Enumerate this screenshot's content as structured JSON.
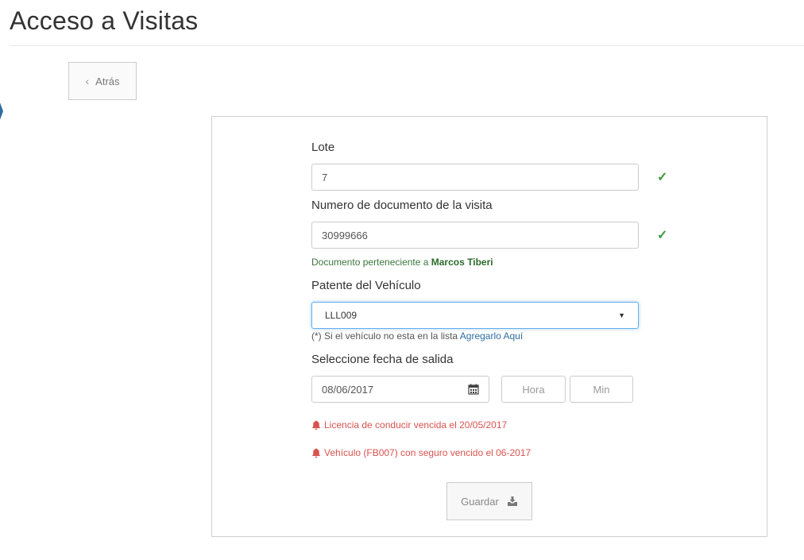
{
  "page": {
    "title": "Acceso a Visitas"
  },
  "back_button": {
    "label": "Atrás",
    "icon": "chevron-left-icon"
  },
  "form": {
    "lote": {
      "label": "Lote",
      "value": "7",
      "valid": true
    },
    "documento": {
      "label": "Numero de documento de la visita",
      "value": "30999666",
      "valid": true,
      "owner_prefix": "Documento perteneciente a ",
      "owner_name": "Marcos Tiberi"
    },
    "patente": {
      "label": "Patente del Vehículo",
      "selected": "LLL009",
      "hint_prefix": "(*) Si el vehículo no esta en la lista ",
      "hint_link": "Agregarlo Aquí"
    },
    "fecha_salida": {
      "label": "Seleccione fecha de salida",
      "date_value": "08/06/2017",
      "hour_placeholder": "Hora",
      "min_placeholder": "Min"
    },
    "alerts": [
      "Licencia de conducir vencida el 20/05/2017",
      "Vehículo (FB007) con seguro vencido el 06-2017"
    ],
    "save_button": {
      "label": "Guardar",
      "icon": "download-icon"
    }
  },
  "colors": {
    "success": "#3c9a3c",
    "danger": "#d9534f",
    "link": "#2e6da4",
    "focus": "#66afe9"
  }
}
